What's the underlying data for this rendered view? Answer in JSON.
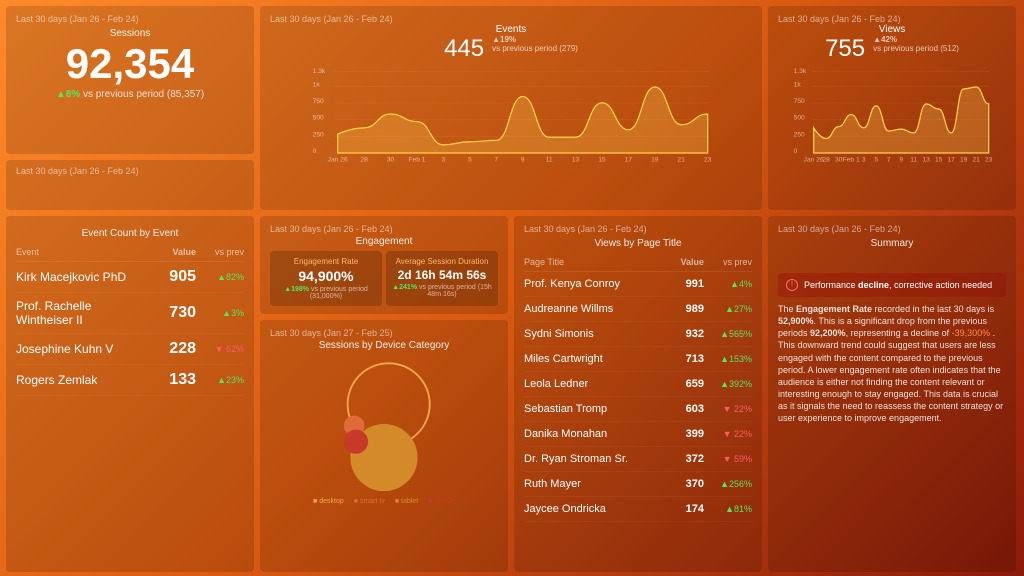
{
  "date_ranges": {
    "main": "Last 30 days (Jan 26 - Feb 24)",
    "device": "Last 30 days (Jan 27 - Feb 25)"
  },
  "sessions": {
    "title": "Sessions",
    "value": "92,354",
    "delta": "▲8%",
    "compare": "vs previous period (85,357)"
  },
  "events_chart": {
    "title": "Events",
    "value": "445",
    "delta": "▲19%",
    "compare": "vs previous period (279)"
  },
  "views_chart": {
    "title": "Views",
    "value": "755",
    "delta": "▲42%",
    "compare": "vs previous period (512)"
  },
  "event_table": {
    "title": "Event Count by Event",
    "head": {
      "event": "Event",
      "value": "Value",
      "prev": "vs prev"
    },
    "rows": [
      {
        "name": "Kirk Macejkovic PhD",
        "value": "905",
        "prev": "▲82%",
        "dir": "up"
      },
      {
        "name": "Prof. Rachelle Wintheiser II",
        "value": "730",
        "prev": "▲3%",
        "dir": "up"
      },
      {
        "name": "Josephine Kuhn V",
        "value": "228",
        "prev": "▼ 62%",
        "dir": "down"
      },
      {
        "name": "Rogers Zemlak",
        "value": "133",
        "prev": "▲23%",
        "dir": "up"
      }
    ]
  },
  "engagement": {
    "title": "Engagement",
    "rate": {
      "label": "Engagement Rate",
      "value": "94,900%",
      "delta": "▲198%",
      "compare": "vs previous period (31,000%)"
    },
    "duration": {
      "label": "Average Session Duration",
      "value": "2d 16h 54m 56s",
      "delta": "▲241%",
      "compare": "vs previous period (15h 48m 16s)"
    }
  },
  "device": {
    "title": "Sessions by Device Category",
    "legend": [
      "desktop",
      "smart tv",
      "tablet",
      "mobile"
    ]
  },
  "page_table": {
    "title": "Views by Page Title",
    "head": {
      "title": "Page Title",
      "value": "Value",
      "prev": "vs prev"
    },
    "rows": [
      {
        "name": "Prof. Kenya Conroy",
        "value": "991",
        "prev": "▲4%",
        "dir": "up"
      },
      {
        "name": "Audreanne Willms",
        "value": "989",
        "prev": "▲27%",
        "dir": "up"
      },
      {
        "name": "Sydni Simonis",
        "value": "932",
        "prev": "▲565%",
        "dir": "up"
      },
      {
        "name": "Miles Cartwright",
        "value": "713",
        "prev": "▲153%",
        "dir": "up"
      },
      {
        "name": "Leola Ledner",
        "value": "659",
        "prev": "▲392%",
        "dir": "up"
      },
      {
        "name": "Sebastian Tromp",
        "value": "603",
        "prev": "▼ 22%",
        "dir": "down"
      },
      {
        "name": "Danika Monahan",
        "value": "399",
        "prev": "▼ 22%",
        "dir": "down"
      },
      {
        "name": "Dr. Ryan Stroman Sr.",
        "value": "372",
        "prev": "▼ 59%",
        "dir": "down"
      },
      {
        "name": "Ruth Mayer",
        "value": "370",
        "prev": "▲256%",
        "dir": "up"
      },
      {
        "name": "Jaycee Ondricka",
        "value": "174",
        "prev": "▲81%",
        "dir": "up"
      }
    ]
  },
  "summary": {
    "title": "Summary",
    "warning": "Performance decline, corrective action needed",
    "body_parts": {
      "a": "The ",
      "bold1": "Engagement Rate",
      "b": " recorded in the last 30 days is ",
      "bold2": "52,900%",
      "c": ". This is a significant drop from the previous periods ",
      "bold3": "92,200%",
      "d": ", representing a decline of ",
      "red": "-39,300%",
      "e": " . This downward trend could suggest that users are less engaged with the content compared to the previous period. A lower engagement rate often indicates that the audience is either not finding the content relevant or interesting enough to stay engaged. This data is crucial as it signals the need to reassess the content strategy or user experience to improve engagement."
    }
  },
  "chart_data": [
    {
      "type": "area",
      "title": "Events",
      "x": [
        "Jan 26",
        "28",
        "30",
        "Feb 1",
        "3",
        "5",
        "7",
        "9",
        "11",
        "13",
        "15",
        "17",
        "19",
        "21",
        "23"
      ],
      "ylim": [
        0,
        1300
      ],
      "yticks": [
        "0",
        "250",
        "500",
        "750",
        "1k",
        "1.3k"
      ],
      "values": [
        300,
        400,
        620,
        500,
        130,
        180,
        200,
        900,
        250,
        250,
        800,
        370,
        1050,
        450,
        620
      ]
    },
    {
      "type": "area",
      "title": "Views",
      "x": [
        "Jan 26",
        "28",
        "30",
        "Feb 1",
        "3",
        "5",
        "7",
        "9",
        "11",
        "13",
        "15",
        "17",
        "19",
        "21",
        "23"
      ],
      "ylim": [
        0,
        1300
      ],
      "yticks": [
        "0",
        "250",
        "500",
        "750",
        "1k",
        "1.3k"
      ],
      "values": [
        400,
        230,
        420,
        610,
        400,
        750,
        350,
        380,
        320,
        780,
        700,
        320,
        1020,
        1050,
        780
      ]
    },
    {
      "type": "bubble",
      "title": "Sessions by Device Category",
      "series": [
        {
          "name": "desktop",
          "value": 45,
          "color": "#f0a94a"
        },
        {
          "name": "smart tv",
          "value": 6,
          "color": "#e06a3a"
        },
        {
          "name": "tablet",
          "value": 38,
          "color": "#d58a2a"
        },
        {
          "name": "mobile",
          "value": 8,
          "color": "#c73a2a"
        }
      ]
    }
  ]
}
